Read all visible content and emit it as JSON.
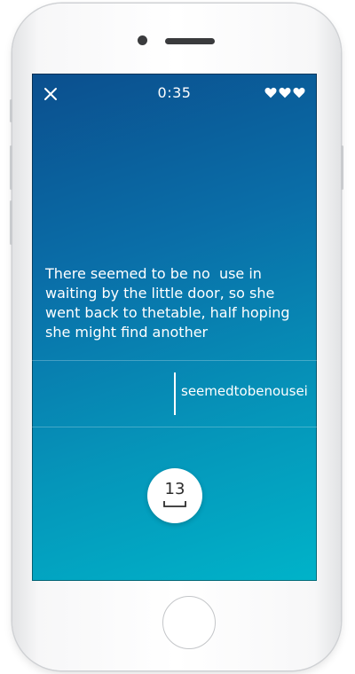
{
  "header": {
    "timer": "0:35",
    "lives_count": 3,
    "icons": [
      "close-icon",
      "heart-icon"
    ]
  },
  "passage": {
    "text": "There seemed to be no  use in waiting by the little door, so she went back to thetable, half hoping she might find another"
  },
  "input": {
    "typed_text": "seemedtobenousei"
  },
  "counter": {
    "value": "13"
  },
  "colors": {
    "gradient_top": "#0b4f8e",
    "gradient_bottom": "#00b3c9",
    "text": "#ffffff"
  }
}
